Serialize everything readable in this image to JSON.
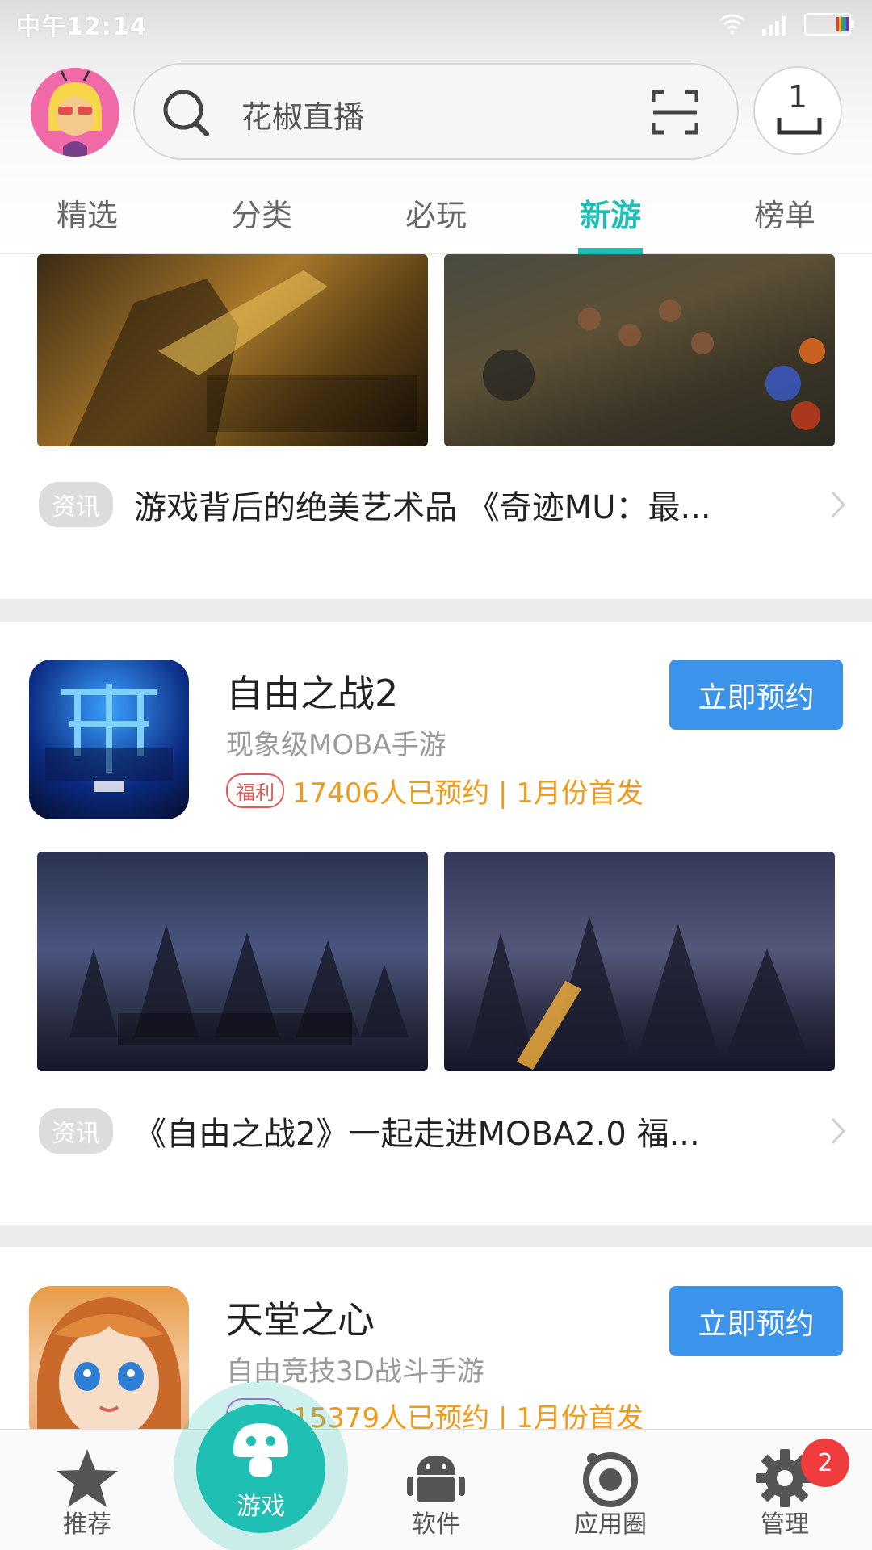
{
  "status_bar": {
    "time": "中午12:14"
  },
  "header": {
    "search_placeholder": "花椒直播",
    "download_count": "1"
  },
  "tabs": [
    {
      "label": "精选"
    },
    {
      "label": "分类"
    },
    {
      "label": "必玩"
    },
    {
      "label": "新游",
      "active": true
    },
    {
      "label": "榜单"
    }
  ],
  "feed": {
    "news1": {
      "tag": "资讯",
      "title": "游戏背后的绝美艺术品 《奇迹MU：最..."
    },
    "app1": {
      "name": "自由之战2",
      "subtitle": "现象级MOBA手游",
      "badge": "福利",
      "meta": "17406人已预约 | 1月份首发",
      "button": "立即预约"
    },
    "news2": {
      "tag": "资讯",
      "title": "《自由之战2》一起走进MOBA2.0 福..."
    },
    "app2": {
      "name": "天堂之心",
      "subtitle": "自由竞技3D战斗手游",
      "badge": "签到",
      "meta": "15379人已预约 | 1月份首发",
      "button": "立即预约"
    }
  },
  "bottom_nav": [
    {
      "label": "推荐",
      "icon": "star-icon"
    },
    {
      "label": "游戏",
      "icon": "mushroom-icon",
      "active": true
    },
    {
      "label": "软件",
      "icon": "android-icon"
    },
    {
      "label": "应用圈",
      "icon": "circle-icon"
    },
    {
      "label": "管理",
      "icon": "gear-icon",
      "badge": "2"
    }
  ],
  "colors": {
    "accent": "#1fc0b3",
    "button": "#3c94ea",
    "meta": "#f29a1a"
  }
}
